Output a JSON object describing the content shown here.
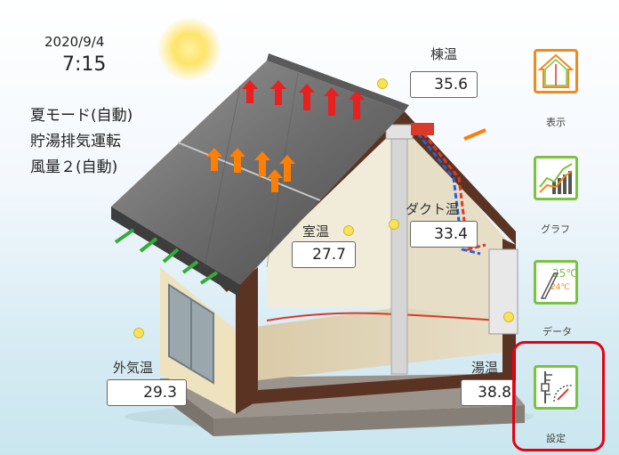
{
  "status": {
    "date": "2020/9/4",
    "time": "7:15",
    "mode_lines": [
      "夏モード(自動)",
      "貯湯排気運転",
      "風量２(自動)"
    ]
  },
  "sensors": {
    "ridge": {
      "label": "棟温",
      "value": "35.6"
    },
    "duct": {
      "label": "ダクト温",
      "value": "33.4"
    },
    "room": {
      "label": "室温",
      "value": "27.7"
    },
    "outdoor": {
      "label": "外気温",
      "value": "29.3"
    },
    "hot_water": {
      "label": "湯温",
      "value": "38.8"
    }
  },
  "side_menu": [
    {
      "label": "表示",
      "icon": "house-display-icon"
    },
    {
      "label": "グラフ",
      "icon": "bar-graph-icon"
    },
    {
      "label": "データ",
      "icon": "temperature-data-icon"
    },
    {
      "label": "設定",
      "icon": "settings-gauge-icon"
    }
  ],
  "colors": {
    "button_border_orange": "#f08a1c",
    "button_border_green": "#7cc242",
    "highlight_red": "#e60012",
    "airflow_orange": "#ff7f00",
    "airflow_red": "#e8201e",
    "airflow_green": "#2fae3a"
  }
}
